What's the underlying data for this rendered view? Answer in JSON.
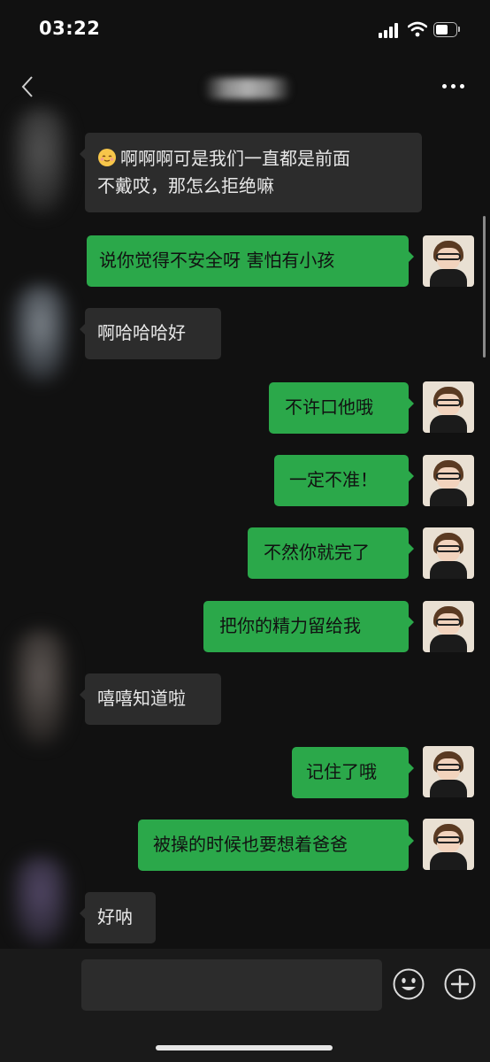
{
  "status_bar": {
    "time": "03:22"
  },
  "nav_bar": {
    "contact_name": ""
  },
  "messages": [
    {
      "side": "in",
      "text": "啊啊啊可是我们一直都是前面不戴哎，那怎么拒绝嘛",
      "line1": "啊啊啊可是我们一直都是前面",
      "line2": "不戴哎，那怎么拒绝嘛",
      "emoji": "smiling-face-icon"
    },
    {
      "side": "out",
      "text": "说你觉得不安全呀  害怕有小孩"
    },
    {
      "side": "in",
      "text": "啊哈哈哈好"
    },
    {
      "side": "out",
      "text": "不许口他哦"
    },
    {
      "side": "out",
      "text": "一定不准！"
    },
    {
      "side": "out",
      "text": "不然你就完了"
    },
    {
      "side": "out",
      "text": "把你的精力留给我"
    },
    {
      "side": "in",
      "text": "嘻嘻知道啦"
    },
    {
      "side": "out",
      "text": "记住了哦"
    },
    {
      "side": "out",
      "text": "被操的时候也要想着爸爸"
    },
    {
      "side": "in",
      "text": "好呐"
    }
  ],
  "input_bar": {
    "placeholder": ""
  },
  "colors": {
    "bubble_out": "#2ba84a",
    "bubble_in": "#2c2c2c",
    "background": "#111111"
  }
}
